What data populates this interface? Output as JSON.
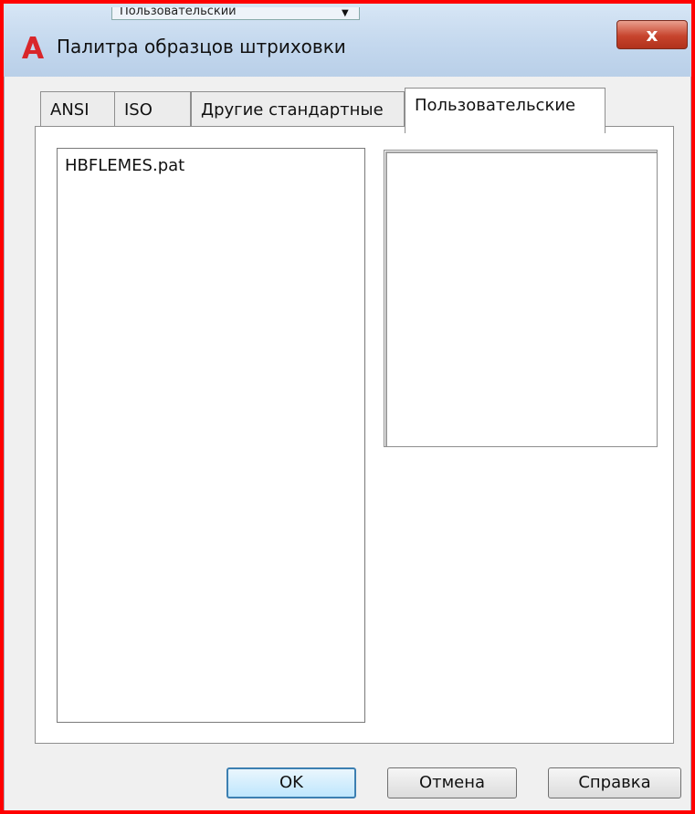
{
  "background_fragment": {
    "text": "Пользовательский",
    "arrow": "▼"
  },
  "window": {
    "title": "Палитра образцов штриховки",
    "close_label": "x"
  },
  "tabs": [
    {
      "label": "ANSI",
      "active": false
    },
    {
      "label": "ISO",
      "active": false
    },
    {
      "label": "Другие стандартные",
      "active": false
    },
    {
      "label": "Пользовательские",
      "active": true
    }
  ],
  "pattern_files": [
    "HBFLEMES.pat"
  ],
  "buttons": {
    "ok": "OK",
    "cancel": "Отмена",
    "help": "Справка"
  },
  "colors": {
    "accent": "#3c7fb1",
    "close": "#c7442d",
    "logo": "#d9262a",
    "highlight_border": "#ff0000"
  }
}
